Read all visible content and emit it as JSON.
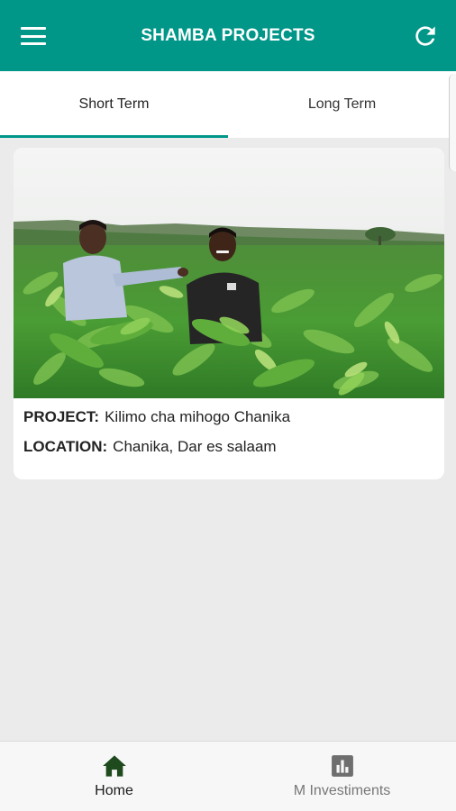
{
  "header": {
    "title": "SHAMBA PROJECTS",
    "menu_icon": "hamburger-menu-icon",
    "refresh_icon": "refresh-icon",
    "bg_color": "#009688"
  },
  "tabs": [
    {
      "label": "Short Term",
      "active": true
    },
    {
      "label": "Long Term",
      "active": false
    }
  ],
  "project": {
    "project_label": "PROJECT:",
    "project_value": "Kilimo cha mihogo Chanika",
    "location_label": "LOCATION:",
    "location_value": "Chanika, Dar es salaam"
  },
  "bottom_nav": [
    {
      "label": "Home",
      "icon": "home-icon",
      "active": true
    },
    {
      "label": "M Investiments",
      "icon": "bar-chart-icon",
      "active": false
    }
  ]
}
